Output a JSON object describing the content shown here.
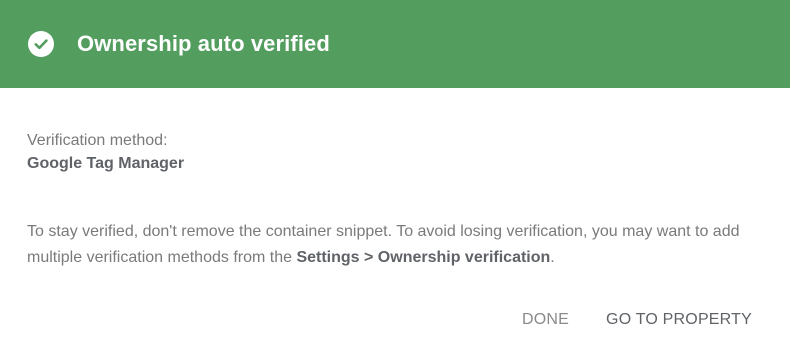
{
  "colors": {
    "header_bg": "#539e5f",
    "header_text": "#ffffff"
  },
  "header": {
    "icon": "check-circle-icon",
    "title": "Ownership auto verified"
  },
  "verification": {
    "label": "Verification method:",
    "value": "Google Tag Manager"
  },
  "info": {
    "text_before": "To stay verified, don't remove the container snippet. To avoid losing verification, you may want to add multiple verification methods from the ",
    "link_text": "Settings > Ownership verification",
    "text_after": "."
  },
  "actions": {
    "done_label": "DONE",
    "go_label": "GO TO PROPERTY"
  }
}
